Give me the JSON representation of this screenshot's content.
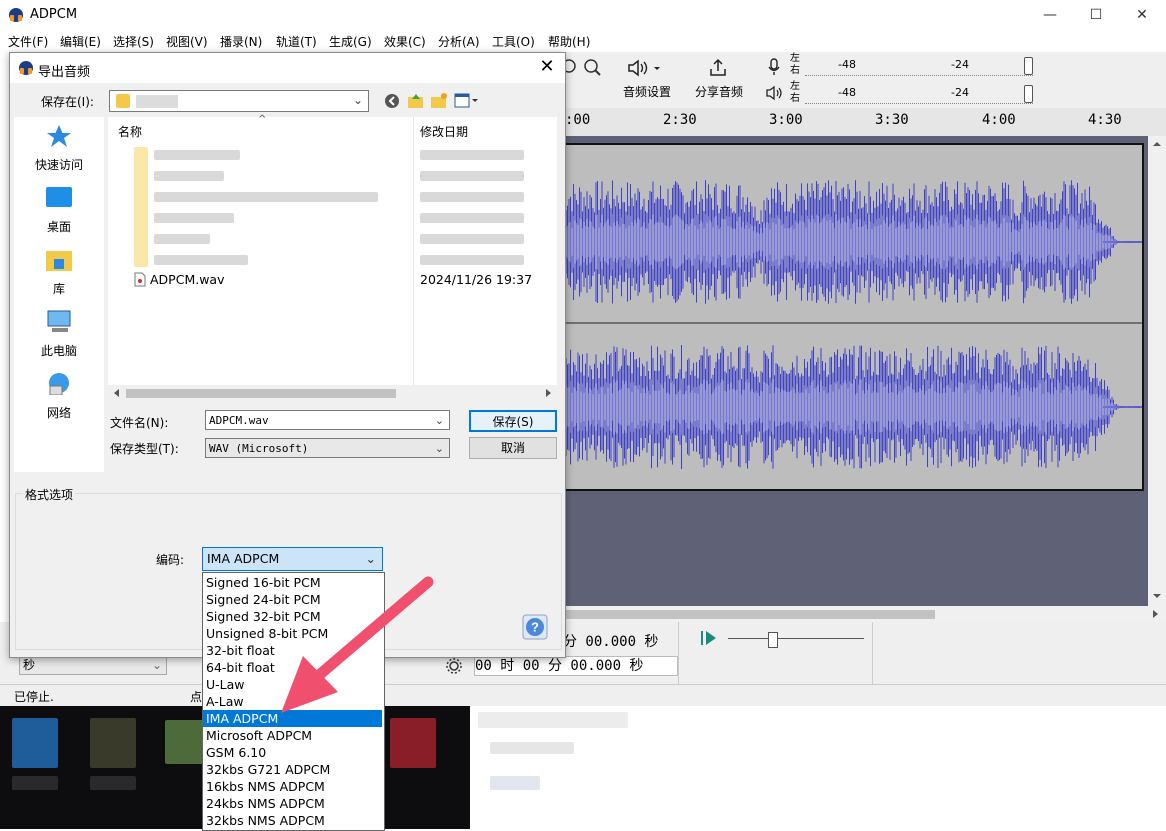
{
  "app": {
    "title": "ADPCM",
    "window_controls": [
      "—",
      "☐",
      "✕"
    ],
    "menu": [
      "文件(F)",
      "编辑(E)",
      "选择(S)",
      "视图(V)",
      "播录(N)",
      "轨道(T)",
      "生成(G)",
      "效果(C)",
      "分析(A)",
      "工具(O)",
      "帮助(H)"
    ],
    "toolbar": {
      "audio_settings": "音频设置",
      "share_audio": "分享音频",
      "meter_left": "左",
      "meter_right": "右",
      "meter_ticks": [
        "-48",
        "-24"
      ]
    },
    "ruler_ticks": [
      ":00",
      "2:30",
      "3:00",
      "3:30",
      "4:00",
      "4:30"
    ],
    "time_display_1": "分 00.000 秒",
    "time_display_2": "00 时 00 分 00.000 秒",
    "snap_unit": "秒",
    "status": "已停止.",
    "status_extra": "点"
  },
  "dialog": {
    "title": "导出音频",
    "save_in_label": "保存在(I):",
    "columns": {
      "name": "名称",
      "date": "修改日期"
    },
    "files": [
      {
        "name": "ADPCM.wav",
        "date": "2024/11/26 19:37"
      }
    ],
    "places": [
      "快速访问",
      "桌面",
      "库",
      "此电脑",
      "网络"
    ],
    "filename_label": "文件名(N):",
    "filename_value": "ADPCM.wav",
    "filetype_label": "保存类型(T):",
    "filetype_value": "WAV (Microsoft)",
    "save_button": "保存(S)",
    "cancel_button": "取消",
    "format_options_label": "格式选项",
    "encoding_label": "编码:",
    "encoding_value": "IMA ADPCM",
    "encoding_options": [
      "Signed 16-bit PCM",
      "Signed 24-bit PCM",
      "Signed 32-bit PCM",
      "Unsigned 8-bit PCM",
      "32-bit float",
      "64-bit float",
      "U-Law",
      "A-Law",
      "IMA ADPCM",
      "Microsoft ADPCM",
      "GSM 6.10",
      "32kbs G721 ADPCM",
      "16kbs NMS ADPCM",
      "24kbs NMS ADPCM",
      "32kbs NMS ADPCM"
    ],
    "selected_encoding_index": 8,
    "help": "?"
  },
  "colors": {
    "waveform": "#3f41c9",
    "waveform_light": "#7577de",
    "selection": "#0078d7",
    "arrow": "#f0506e"
  }
}
